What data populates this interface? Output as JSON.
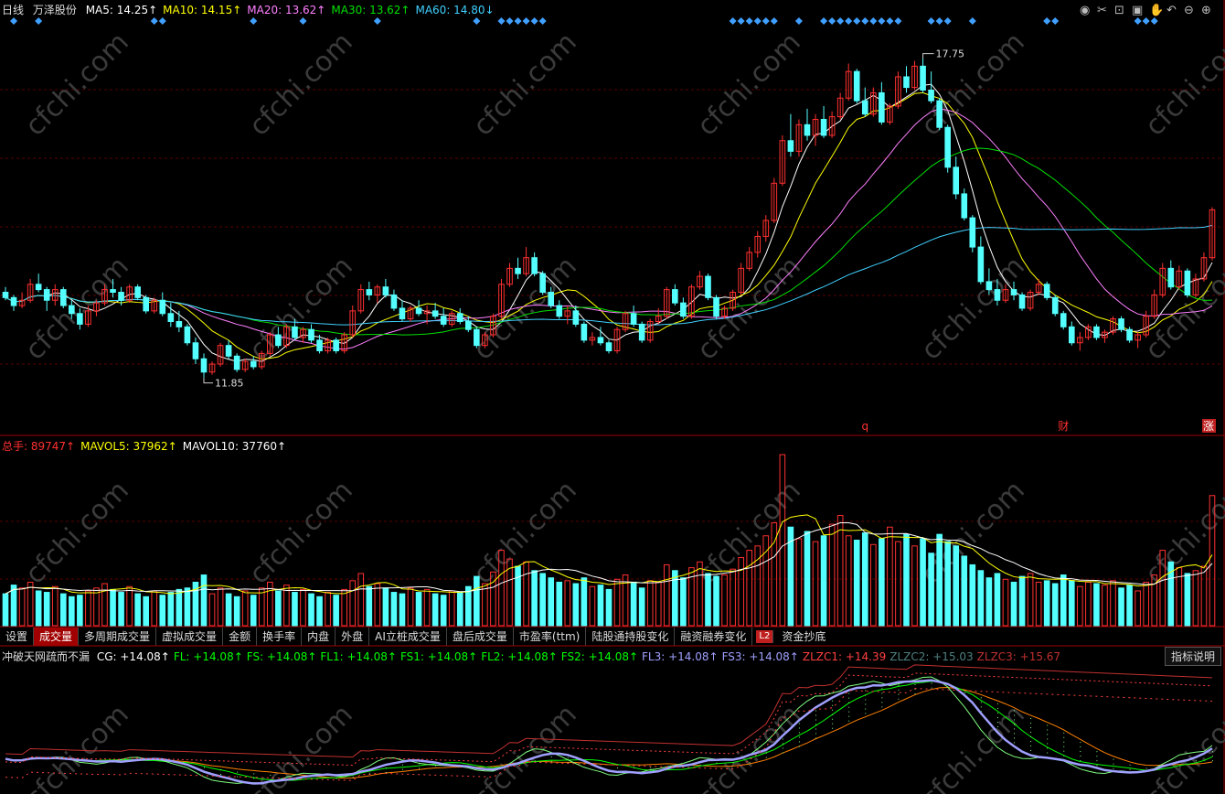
{
  "header": {
    "period": "日线",
    "stock_name": "万泽股份",
    "ma": [
      {
        "label": "MA5: 14.25↑",
        "color": "#ffffff"
      },
      {
        "label": "MA10: 14.15↑",
        "color": "#ffff00"
      },
      {
        "label": "MA20: 13.62↑",
        "color": "#ff80ff"
      },
      {
        "label": "MA30: 13.62↑",
        "color": "#00e000"
      },
      {
        "label": "MA60: 14.80↓",
        "color": "#40d0ff"
      }
    ]
  },
  "toolbar_icons": [
    "eye-icon",
    "scissors-icon",
    "lock-icon",
    "save-icon",
    "hand-icon",
    "undo-icon",
    "zoom-out-icon",
    "zoom-in-icon"
  ],
  "price_chart": {
    "high_label": "17.75",
    "low_label": "11.85",
    "marks": [
      {
        "text": "q",
        "color": "#ff3030"
      },
      {
        "text": "财",
        "color": "#ff3030"
      },
      {
        "text": "涨",
        "color": "#ffffff",
        "bg": "#c02020"
      }
    ],
    "signal_color": "#40a0ff"
  },
  "volume": {
    "legend": [
      {
        "label": "总手: 89747↑",
        "color": "#ff3030"
      },
      {
        "label": "MAVOL5: 37962↑",
        "color": "#ffff00"
      },
      {
        "label": "MAVOL10: 37760↑",
        "color": "#ffffff"
      }
    ]
  },
  "tabs": [
    "设置",
    "成交量",
    "多周期成交量",
    "虚拟成交量",
    "金额",
    "换手率",
    "内盘",
    "外盘",
    "AI立桩成交量",
    "盘后成交量",
    "市盈率(ttm)",
    "陆股通持股变化",
    "融资融券变化",
    "资金抄底"
  ],
  "active_tab": 1,
  "l2_badge": "L2",
  "indicator": {
    "name": "冲破天网疏而不漏",
    "values": [
      {
        "label": "CG: +14.08↑",
        "color": "#ffffff"
      },
      {
        "label": "FL: +14.08↑",
        "color": "#00ff00"
      },
      {
        "label": "FS: +14.08↑",
        "color": "#00ff00"
      },
      {
        "label": "FL1: +14.08↑",
        "color": "#00ff00"
      },
      {
        "label": "FS1: +14.08↑",
        "color": "#00ff00"
      },
      {
        "label": "FL2: +14.08↑",
        "color": "#00ff00"
      },
      {
        "label": "FS2: +14.08↑",
        "color": "#00ff00"
      },
      {
        "label": "FL3: +14.08↑",
        "color": "#a0a0ff"
      },
      {
        "label": "FS3: +14.08↑",
        "color": "#a0a0ff"
      },
      {
        "label": "ZLZC1: +14.39",
        "color": "#ff4040"
      },
      {
        "label": "ZLZC2: +15.03",
        "color": "#508080"
      },
      {
        "label": "ZLZC3: +15.67",
        "color": "#c03030"
      }
    ],
    "help_label": "指标说明"
  },
  "watermark": "cfchi.com",
  "chart_data": {
    "type": "candlestick",
    "title": "万泽股份 日线",
    "ylim": [
      11.0,
      18.6
    ],
    "ohlc": [
      [
        13.45,
        13.55,
        13.3,
        13.35
      ],
      [
        13.35,
        13.4,
        13.1,
        13.2
      ],
      [
        13.2,
        13.45,
        13.15,
        13.3
      ],
      [
        13.3,
        13.7,
        13.25,
        13.6
      ],
      [
        13.6,
        13.8,
        13.45,
        13.5
      ],
      [
        13.5,
        13.55,
        13.1,
        13.3
      ],
      [
        13.3,
        13.6,
        13.2,
        13.5
      ],
      [
        13.5,
        13.55,
        13.15,
        13.2
      ],
      [
        13.2,
        13.3,
        12.95,
        13.05
      ],
      [
        13.05,
        13.15,
        12.75,
        12.85
      ],
      [
        12.85,
        13.2,
        12.8,
        13.1
      ],
      [
        13.1,
        13.3,
        13.0,
        13.25
      ],
      [
        13.25,
        13.6,
        13.2,
        13.5
      ],
      [
        13.5,
        13.7,
        13.35,
        13.45
      ],
      [
        13.45,
        13.55,
        13.2,
        13.3
      ],
      [
        13.3,
        13.6,
        13.25,
        13.55
      ],
      [
        13.55,
        13.6,
        13.3,
        13.35
      ],
      [
        13.35,
        13.4,
        13.05,
        13.1
      ],
      [
        13.1,
        13.35,
        13.05,
        13.3
      ],
      [
        13.3,
        13.45,
        13.0,
        13.05
      ],
      [
        13.05,
        13.25,
        12.8,
        12.9
      ],
      [
        12.9,
        13.1,
        12.7,
        12.8
      ],
      [
        12.8,
        12.85,
        12.45,
        12.5
      ],
      [
        12.5,
        12.6,
        12.1,
        12.2
      ],
      [
        12.2,
        12.3,
        11.85,
        11.95
      ],
      [
        11.95,
        12.15,
        11.9,
        12.1
      ],
      [
        12.1,
        12.5,
        12.05,
        12.45
      ],
      [
        12.45,
        12.55,
        12.2,
        12.25
      ],
      [
        12.25,
        12.3,
        11.95,
        12.0
      ],
      [
        12.0,
        12.2,
        11.95,
        12.15
      ],
      [
        12.15,
        12.25,
        12.0,
        12.05
      ],
      [
        12.05,
        12.35,
        12.0,
        12.3
      ],
      [
        12.3,
        12.7,
        12.25,
        12.65
      ],
      [
        12.65,
        12.8,
        12.4,
        12.45
      ],
      [
        12.45,
        12.85,
        12.4,
        12.8
      ],
      [
        12.8,
        12.95,
        12.55,
        12.6
      ],
      [
        12.6,
        12.8,
        12.5,
        12.75
      ],
      [
        12.75,
        12.85,
        12.5,
        12.55
      ],
      [
        12.55,
        12.65,
        12.3,
        12.35
      ],
      [
        12.35,
        12.6,
        12.3,
        12.55
      ],
      [
        12.55,
        12.6,
        12.3,
        12.35
      ],
      [
        12.35,
        12.7,
        12.3,
        12.65
      ],
      [
        12.65,
        13.2,
        12.6,
        13.1
      ],
      [
        13.1,
        13.6,
        13.05,
        13.5
      ],
      [
        13.5,
        13.65,
        13.3,
        13.4
      ],
      [
        13.4,
        13.6,
        13.25,
        13.55
      ],
      [
        13.55,
        13.7,
        13.35,
        13.4
      ],
      [
        13.4,
        13.5,
        13.1,
        13.15
      ],
      [
        13.15,
        13.3,
        12.9,
        12.95
      ],
      [
        12.95,
        13.2,
        12.9,
        13.15
      ],
      [
        13.15,
        13.3,
        13.0,
        13.05
      ],
      [
        13.05,
        13.2,
        12.85,
        13.1
      ],
      [
        13.1,
        13.25,
        12.95,
        13.0
      ],
      [
        13.0,
        13.15,
        12.8,
        12.85
      ],
      [
        12.85,
        13.1,
        12.8,
        13.05
      ],
      [
        13.05,
        13.15,
        12.85,
        12.9
      ],
      [
        12.9,
        13.0,
        12.7,
        12.75
      ],
      [
        12.75,
        12.8,
        12.4,
        12.45
      ],
      [
        12.45,
        12.7,
        12.4,
        12.65
      ],
      [
        12.65,
        13.05,
        12.6,
        13.0
      ],
      [
        13.0,
        13.7,
        12.95,
        13.6
      ],
      [
        13.6,
        14.0,
        13.55,
        13.9
      ],
      [
        13.9,
        14.1,
        13.7,
        13.8
      ],
      [
        13.8,
        14.3,
        13.75,
        14.1
      ],
      [
        14.1,
        14.2,
        13.75,
        13.8
      ],
      [
        13.8,
        13.85,
        13.4,
        13.45
      ],
      [
        13.45,
        13.55,
        13.15,
        13.2
      ],
      [
        13.2,
        13.3,
        12.95,
        13.0
      ],
      [
        13.0,
        13.2,
        12.85,
        13.1
      ],
      [
        13.1,
        13.2,
        12.8,
        12.85
      ],
      [
        12.85,
        12.9,
        12.5,
        12.55
      ],
      [
        12.55,
        12.7,
        12.45,
        12.6
      ],
      [
        12.6,
        12.8,
        12.45,
        12.5
      ],
      [
        12.5,
        12.55,
        12.3,
        12.35
      ],
      [
        12.35,
        12.8,
        12.3,
        12.75
      ],
      [
        12.75,
        13.1,
        12.7,
        13.05
      ],
      [
        13.05,
        13.2,
        12.8,
        12.85
      ],
      [
        12.85,
        12.9,
        12.5,
        12.55
      ],
      [
        12.55,
        12.95,
        12.5,
        12.9
      ],
      [
        12.9,
        13.15,
        12.85,
        13.0
      ],
      [
        13.0,
        13.55,
        12.95,
        13.5
      ],
      [
        13.5,
        13.6,
        13.2,
        13.25
      ],
      [
        13.25,
        13.35,
        12.95,
        13.0
      ],
      [
        13.0,
        13.6,
        12.95,
        13.55
      ],
      [
        13.55,
        13.85,
        13.5,
        13.75
      ],
      [
        13.75,
        13.8,
        13.3,
        13.35
      ],
      [
        13.35,
        13.4,
        12.95,
        13.0
      ],
      [
        13.0,
        13.2,
        12.95,
        13.15
      ],
      [
        13.15,
        13.5,
        13.1,
        13.45
      ],
      [
        13.45,
        14.0,
        13.4,
        13.9
      ],
      [
        13.9,
        14.3,
        13.85,
        14.2
      ],
      [
        14.2,
        14.6,
        14.1,
        14.5
      ],
      [
        14.5,
        14.9,
        14.4,
        14.8
      ],
      [
        14.8,
        15.6,
        14.75,
        15.5
      ],
      [
        15.5,
        16.4,
        15.45,
        16.3
      ],
      [
        16.3,
        16.8,
        16.0,
        16.1
      ],
      [
        16.1,
        16.7,
        16.0,
        16.6
      ],
      [
        16.6,
        16.9,
        16.3,
        16.4
      ],
      [
        16.4,
        16.8,
        16.2,
        16.7
      ],
      [
        16.7,
        16.95,
        16.35,
        16.4
      ],
      [
        16.4,
        16.85,
        16.35,
        16.75
      ],
      [
        16.75,
        17.2,
        16.7,
        17.1
      ],
      [
        17.1,
        17.75,
        17.05,
        17.6
      ],
      [
        17.6,
        17.65,
        17.0,
        17.05
      ],
      [
        17.05,
        17.3,
        16.75,
        16.8
      ],
      [
        16.8,
        17.3,
        16.75,
        17.2
      ],
      [
        17.2,
        17.4,
        16.6,
        16.65
      ],
      [
        16.65,
        17.0,
        16.6,
        16.95
      ],
      [
        16.95,
        17.6,
        16.9,
        17.5
      ],
      [
        17.5,
        17.7,
        17.2,
        17.3
      ],
      [
        17.3,
        17.8,
        17.25,
        17.7
      ],
      [
        17.7,
        17.85,
        17.2,
        17.25
      ],
      [
        17.25,
        17.6,
        17.0,
        17.05
      ],
      [
        17.05,
        17.1,
        16.5,
        16.55
      ],
      [
        16.55,
        16.6,
        15.7,
        15.8
      ],
      [
        15.8,
        16.0,
        15.2,
        15.3
      ],
      [
        15.3,
        15.4,
        14.8,
        14.85
      ],
      [
        14.85,
        14.9,
        14.2,
        14.3
      ],
      [
        14.3,
        14.5,
        13.6,
        13.65
      ],
      [
        13.65,
        13.9,
        13.4,
        13.5
      ],
      [
        13.5,
        13.7,
        13.2,
        13.3
      ],
      [
        13.3,
        13.6,
        13.25,
        13.5
      ],
      [
        13.5,
        13.65,
        13.3,
        13.4
      ],
      [
        13.4,
        13.45,
        13.1,
        13.15
      ],
      [
        13.15,
        13.5,
        13.1,
        13.45
      ],
      [
        13.45,
        13.7,
        13.4,
        13.6
      ],
      [
        13.6,
        13.65,
        13.3,
        13.35
      ],
      [
        13.35,
        13.4,
        13.0,
        13.05
      ],
      [
        13.05,
        13.1,
        12.75,
        12.8
      ],
      [
        12.8,
        12.9,
        12.45,
        12.5
      ],
      [
        12.5,
        12.7,
        12.35,
        12.6
      ],
      [
        12.6,
        12.85,
        12.55,
        12.8
      ],
      [
        12.8,
        12.85,
        12.55,
        12.6
      ],
      [
        12.6,
        12.75,
        12.5,
        12.7
      ],
      [
        12.7,
        13.0,
        12.65,
        12.95
      ],
      [
        12.95,
        13.0,
        12.7,
        12.75
      ],
      [
        12.75,
        12.8,
        12.5,
        12.55
      ],
      [
        12.55,
        12.7,
        12.4,
        12.65
      ],
      [
        12.65,
        13.1,
        12.6,
        13.0
      ],
      [
        13.0,
        13.5,
        12.95,
        13.4
      ],
      [
        13.4,
        14.0,
        13.35,
        13.9
      ],
      [
        13.9,
        14.05,
        13.5,
        13.55
      ],
      [
        13.55,
        13.95,
        13.5,
        13.85
      ],
      [
        13.85,
        13.9,
        13.35,
        13.4
      ],
      [
        13.4,
        13.8,
        13.35,
        13.7
      ],
      [
        13.7,
        14.2,
        13.65,
        14.1
      ],
      [
        14.1,
        15.05,
        14.05,
        15.0
      ]
    ],
    "volume": [
      22000,
      28000,
      26000,
      30000,
      24000,
      23000,
      27000,
      22000,
      20000,
      21000,
      24000,
      26000,
      29000,
      25000,
      23000,
      27000,
      22000,
      20000,
      24000,
      21000,
      23000,
      25000,
      26000,
      30000,
      35000,
      22000,
      26000,
      22000,
      20000,
      24000,
      21000,
      26000,
      30000,
      24000,
      28000,
      23000,
      25000,
      22000,
      20000,
      23000,
      21000,
      25000,
      31000,
      36000,
      27000,
      29000,
      26000,
      23000,
      22000,
      26000,
      23000,
      25000,
      22000,
      21000,
      24000,
      23000,
      27000,
      34000,
      29000,
      37000,
      52000,
      46000,
      41000,
      44000,
      38000,
      36000,
      33000,
      30000,
      31000,
      29000,
      33000,
      27000,
      28000,
      25000,
      32000,
      35000,
      30000,
      26000,
      31000,
      30000,
      42000,
      38000,
      33000,
      40000,
      44000,
      36000,
      34000,
      35000,
      39000,
      47000,
      52000,
      55000,
      62000,
      71000,
      118000,
      68000,
      60000,
      65000,
      58000,
      62000,
      70000,
      76000,
      62000,
      59000,
      64000,
      56000,
      60000,
      68000,
      58000,
      63000,
      55000,
      60000,
      50000,
      63000,
      58000,
      55000,
      48000,
      42000,
      38000,
      33000,
      36000,
      32000,
      30000,
      34000,
      36000,
      30000,
      31000,
      29000,
      35000,
      31000,
      27000,
      30000,
      29000,
      28000,
      31000,
      26000,
      28000,
      24000,
      30000,
      35000,
      52000,
      44000,
      40000,
      36000,
      38000,
      41000,
      89747
    ],
    "series_lines": [
      "MA5",
      "MA10",
      "MA20",
      "MA30",
      "MA60",
      "MAVOL5",
      "MAVOL10",
      "CG",
      "FL",
      "FS",
      "FL1",
      "FS1",
      "FL2",
      "FS2",
      "FL3",
      "FS3",
      "ZLZC1",
      "ZLZC2",
      "ZLZC3"
    ]
  }
}
